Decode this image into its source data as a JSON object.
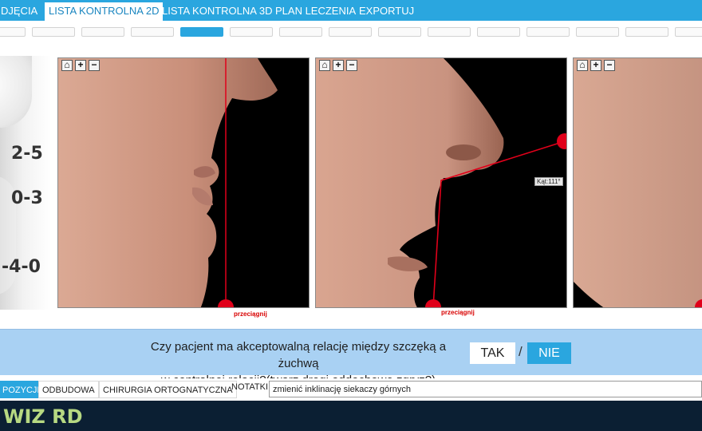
{
  "top_tabs": [
    {
      "label": "DJĘCIA",
      "active": false
    },
    {
      "label": "LISTA KONTROLNA 2D",
      "active": true
    },
    {
      "label": "LISTA KONTROLNA 3D",
      "active": false
    },
    {
      "label": "PLAN LECZENIA",
      "active": false
    },
    {
      "label": "EXPORTUJ",
      "active": false
    }
  ],
  "steps": {
    "count": 15,
    "active_index": 4
  },
  "reference": {
    "labels": [
      "2-5",
      "0-3",
      "-4-0"
    ]
  },
  "panels": [
    {
      "drag_label": "przeciągnij"
    },
    {
      "drag_label": "przeciągnij",
      "angle_label": "Kąt:111°"
    },
    {}
  ],
  "question": {
    "line1": "Czy pacjent ma akceptowalną relację między szczęką a żuchwą",
    "line2": "w centralnej relacji?(twarz,drogi oddechowe,zgryz?)",
    "yes_label": "TAK",
    "separator": "/",
    "no_label": "NIE"
  },
  "bottom_tabs": [
    {
      "label": "POZYCJI",
      "active": true
    },
    {
      "label": "ODBUDOWA",
      "active": false
    },
    {
      "label": "CHIRURGIA ORTOGNATYCZNA",
      "active": false
    }
  ],
  "notes": {
    "label": "NOTATKI:",
    "value": "zmienić inklinację siekaczy górnych"
  },
  "footer": {
    "logo": "WIZ RD"
  },
  "colors": {
    "accent": "#2aa6df",
    "marker": "#e0001a",
    "banner": "#a9d1f3",
    "footer": "#0b1f33"
  }
}
